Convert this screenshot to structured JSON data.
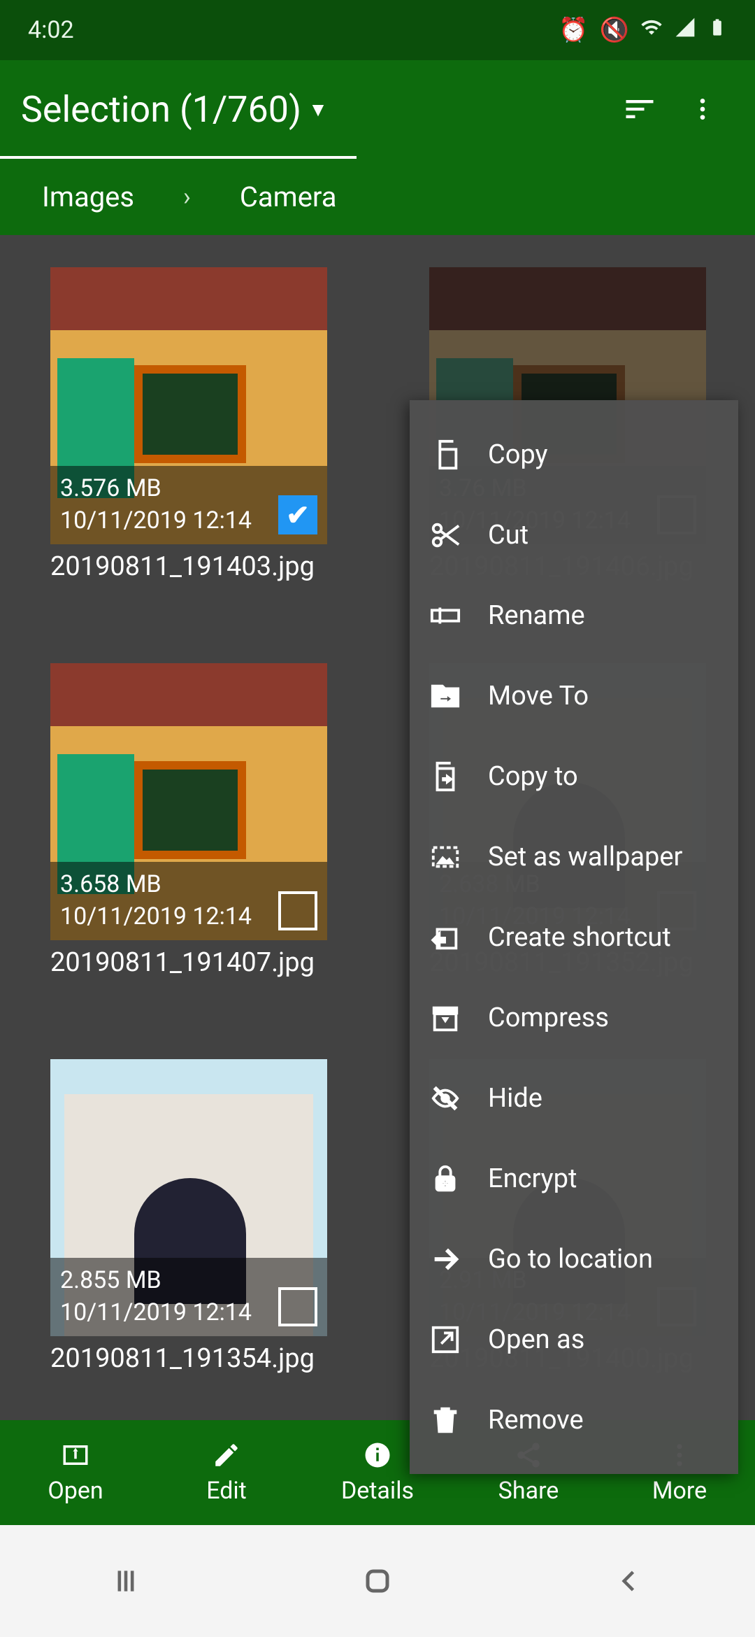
{
  "status": {
    "time": "4:02"
  },
  "header": {
    "title": "Selection (1/760)"
  },
  "breadcrumb": {
    "root": "Images",
    "current": "Camera"
  },
  "tiles": [
    {
      "size": "3.576 MB",
      "date": "10/11/2019 12:14",
      "filename": "20190811_191403.jpg",
      "selected": true
    },
    {
      "size": "3.76 MB",
      "date": "10/11/2019 12:14",
      "filename": "20190811_191406.jpg",
      "selected": false
    },
    {
      "size": "3.658 MB",
      "date": "10/11/2019 12:14",
      "filename": "20190811_191407.jpg",
      "selected": false
    },
    {
      "size": "2.638 MB",
      "date": "10/11/2019 12:14",
      "filename": "20190811_191352.jpg",
      "selected": false
    },
    {
      "size": "2.855 MB",
      "date": "10/11/2019 12:14",
      "filename": "20190811_191354.jpg",
      "selected": false
    },
    {
      "size": "2.91 MB",
      "date": "10/11/2019 12:14",
      "filename": "20190811_191400.jpg",
      "selected": false
    }
  ],
  "context_menu": {
    "items": [
      {
        "label": "Copy",
        "icon": "copy"
      },
      {
        "label": "Cut",
        "icon": "cut"
      },
      {
        "label": "Rename",
        "icon": "rename"
      },
      {
        "label": "Move To",
        "icon": "moveto"
      },
      {
        "label": "Copy to",
        "icon": "copyto"
      },
      {
        "label": "Set as wallpaper",
        "icon": "wallpaper"
      },
      {
        "label": "Create shortcut",
        "icon": "shortcut"
      },
      {
        "label": "Compress",
        "icon": "compress"
      },
      {
        "label": "Hide",
        "icon": "hide"
      },
      {
        "label": "Encrypt",
        "icon": "encrypt"
      },
      {
        "label": "Go to location",
        "icon": "goto"
      },
      {
        "label": "Open as",
        "icon": "openas"
      },
      {
        "label": "Remove",
        "icon": "remove"
      }
    ]
  },
  "bottom_bar": {
    "open": "Open",
    "edit": "Edit",
    "details": "Details",
    "share": "Share",
    "more": "More"
  }
}
